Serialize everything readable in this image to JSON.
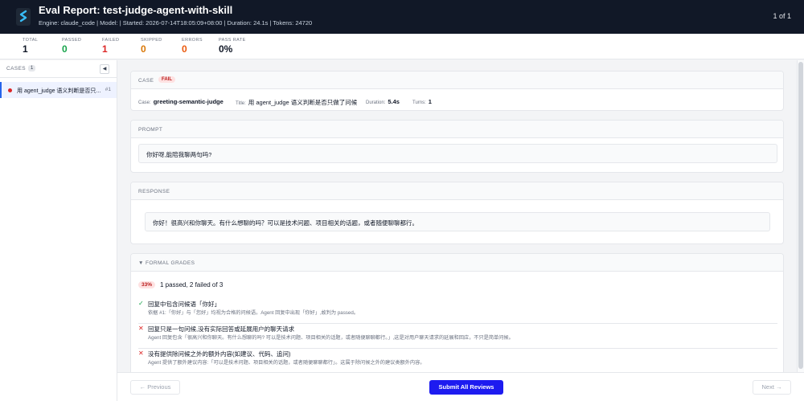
{
  "header": {
    "title": "Eval Report: test-judge-agent-with-skill",
    "meta": "Engine: claude_code | Model: | Started: 2026-07-14T18:05:09+08:00 | Duration: 24.1s | Tokens: 24720",
    "pager": "1 of 1",
    "logo_icon": "brand-logo-icon"
  },
  "stats": [
    {
      "label": "TOTAL",
      "value": "1",
      "color": "#111827"
    },
    {
      "label": "PASSED",
      "value": "0",
      "color": "#16a34a"
    },
    {
      "label": "FAILED",
      "value": "1",
      "color": "#dc2626"
    },
    {
      "label": "SKIPPED",
      "value": "0",
      "color": "#d97706"
    },
    {
      "label": "ERRORS",
      "value": "0",
      "color": "#ea580c"
    },
    {
      "label": "PASS RATE",
      "value": "0%",
      "color": "#111827"
    }
  ],
  "sidebar": {
    "label": "CASES",
    "count": "1",
    "collapse_icon": "◀",
    "items": [
      {
        "name": "用 agent_judge 语义判断是否只...",
        "num": "#1",
        "status_color": "#dc2626"
      }
    ]
  },
  "case_card": {
    "label": "CASE",
    "badge": "FAIL",
    "case_key": "Case:",
    "case_value": "greeting-semantic-judge",
    "title_key": "Title:",
    "title_value": "用 agent_judge 语义判断是否只做了问候",
    "duration_key": "Duration:",
    "duration_value": "5.4s",
    "turns_key": "Turns:",
    "turns_value": "1"
  },
  "prompt_card": {
    "label": "PROMPT",
    "text": "你好呀,能陪我聊两句吗?"
  },
  "response_card": {
    "label": "RESPONSE",
    "text": "你好！很高兴和你聊天。有什么想聊的吗？可以是技术问题、项目相关的话题，或者随便聊聊都行。"
  },
  "grades_card": {
    "label": "▼  FORMAL GRADES",
    "pct": "33%",
    "summary": "1 passed, 2 failed of 3",
    "items": [
      {
        "mark": "✓",
        "color": "#16a34a",
        "text": "回复中包含问候语「你好」",
        "evidence": "依据 #1:「你好」与「您好」均视为合格的问候语。Agent 回复中出现「你好」,故判为 passed。"
      },
      {
        "mark": "✕",
        "color": "#dc2626",
        "text": "回复只是一句问候,没有实际回答或延展用户的聊天请求",
        "evidence": "Agent 回复包含「很高兴和你聊天。有什么想聊的吗? 可以是技术问题、项目相关的话题，或者随便聊聊都行。」,这是对用户聊天请求的延展和回应，不只是简单问候。"
      },
      {
        "mark": "✕",
        "color": "#dc2626",
        "text": "没有提供除问候之外的额外内容(如建议、代码、追问)",
        "evidence": "Agent 提供了额外建议内容:「可以是技术问题、项目相关的话题，或者随便聊聊都行」。这属于除问候之外的建议类额外内容。"
      }
    ]
  },
  "footer": {
    "prev": "← Previous",
    "submit": "Submit All Reviews",
    "next": "Next →"
  }
}
